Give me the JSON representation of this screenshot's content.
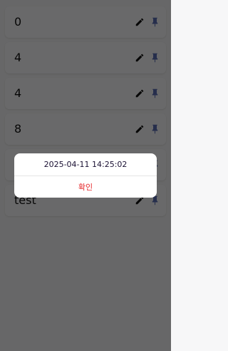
{
  "list": {
    "items": [
      {
        "label": "0"
      },
      {
        "label": "4"
      },
      {
        "label": "4"
      },
      {
        "label": "8"
      },
      {
        "label": ""
      },
      {
        "label": "test"
      }
    ]
  },
  "icons": {
    "edit": "pencil-icon",
    "pin": "pin-icon",
    "pin_color": "#5b6fb5"
  },
  "dialog": {
    "message": "2025-04-11 14:25:02",
    "confirm_label": "확인",
    "confirm_color": "#e5272a"
  }
}
